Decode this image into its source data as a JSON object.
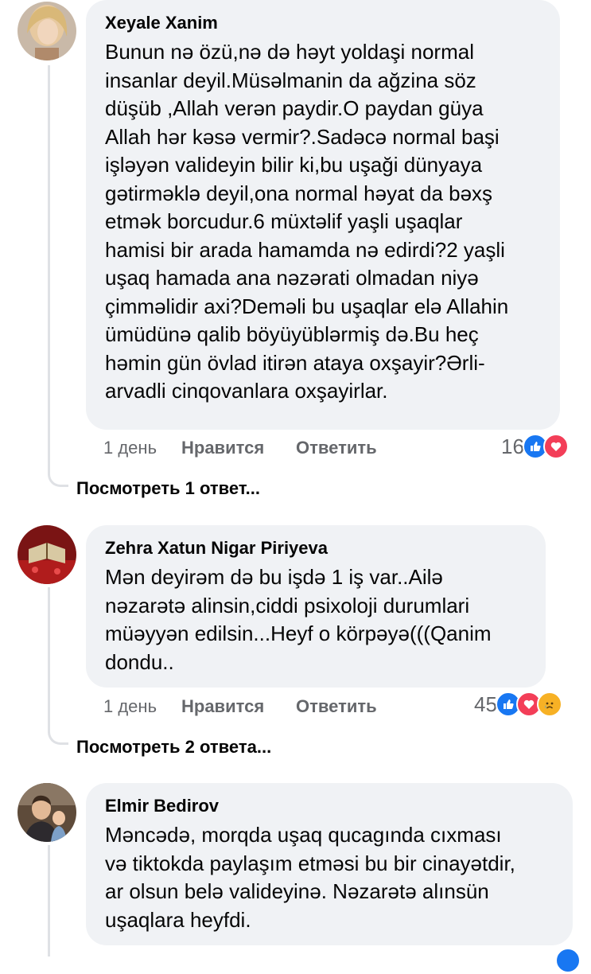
{
  "comments": [
    {
      "author": "Xeyale Xanim",
      "text": "Bunun nə özü,nə də həyt yoldaşi normal\ninsanlar deyil.Müsəlmanin da ağzina söz\ndüşüb ,Allah verən paydir.O paydan güya\nAllah hər kəsə vermir?.Sadəcə normal başi\nişləyən valideyin bilir ki,bu uşaği dünyaya\ngətirməklə deyil,ona normal həyat da bəxş\netmək borcudur.6 müxtəlif yaşli uşaqlar\nhamisi bir arada hamamda nə edirdi?2 yaşli\nuşaq hamada ana nəzərati olmadan niyə\nçimməlidir axi?Deməli bu uşaqlar elə Allahin\nümüdünə qalib böyüyüblərmiş də.Bu heç\nhəmin gün övlad itirən ataya oxşayir?Ərli-\narvadli cinqovanlara oxşayirlar.",
      "time": "1 день",
      "like_label": "Нравится",
      "reply_label": "Ответить",
      "reaction_count": "16",
      "reactions": [
        "like-reaction-icon",
        "love-reaction-icon"
      ],
      "view_replies": "Посмотреть 1 ответ..."
    },
    {
      "author": "Zehra Xatun Nigar Piriyeva",
      "text": "Mən deyirəm də bu işdə 1 iş var..Ailə\nnəzarətə alinsin,ciddi psixoloji durumlari\nmüəyyən edilsin...Heyf o körpəyə(((Qanim\ndondu..",
      "time": "1 день",
      "like_label": "Нравится",
      "reply_label": "Ответить",
      "reaction_count": "45",
      "reactions": [
        "like-reaction-icon",
        "love-reaction-icon",
        "sad-reaction-icon"
      ],
      "view_replies": "Посмотреть 2 ответа..."
    },
    {
      "author": "Elmir Bedirov",
      "text": "Məncədə, morqda uşaq qucagında cıxması\nvə tiktokda paylaşım etməsi bu bir cinayətdir,\nar olsun belə valideyinə. Nəzarətə alınsün\nuşaqlara heyfdi."
    }
  ],
  "colors": {
    "bubble": "#f0f2f5",
    "meta": "#65676b",
    "like": "#1877f2",
    "love": "#f33e58",
    "sad": "#f7b125"
  }
}
